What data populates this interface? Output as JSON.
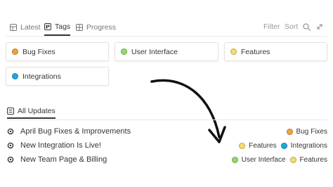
{
  "view_tabs": [
    {
      "label": "Latest",
      "icon": "table-icon"
    },
    {
      "label": "Tags",
      "icon": "board-icon",
      "active": true
    },
    {
      "label": "Progress",
      "icon": "gallery-icon"
    }
  ],
  "toolbar": {
    "filter_label": "Filter",
    "sort_label": "Sort",
    "search_icon": "search-icon",
    "expand_icon": "expand-icon"
  },
  "tag_cards": [
    {
      "label": "Bug Fixes",
      "color": "#f2a33a"
    },
    {
      "label": "User Interface",
      "color": "#8fdc6b"
    },
    {
      "label": "Features",
      "color": "#f3df6a"
    },
    {
      "label": "Integrations",
      "color": "#1fa8e0"
    }
  ],
  "updates_tab": {
    "label": "All Updates",
    "icon": "list-icon"
  },
  "updates": [
    {
      "title": "April Bug Fixes & Improvements",
      "tags": [
        "Bug Fixes"
      ]
    },
    {
      "title": "New Integration Is Live!",
      "tags": [
        "Features",
        "Integrations"
      ]
    },
    {
      "title": "New Team Page & Billing",
      "tags": [
        "User Interface",
        "Features"
      ]
    }
  ],
  "colors": {
    "bug_fixes": "#f2a33a",
    "user_interface": "#8fdc6b",
    "features": "#f3df6a",
    "integrations": "#1fa8e0",
    "arrow": "#111111"
  }
}
